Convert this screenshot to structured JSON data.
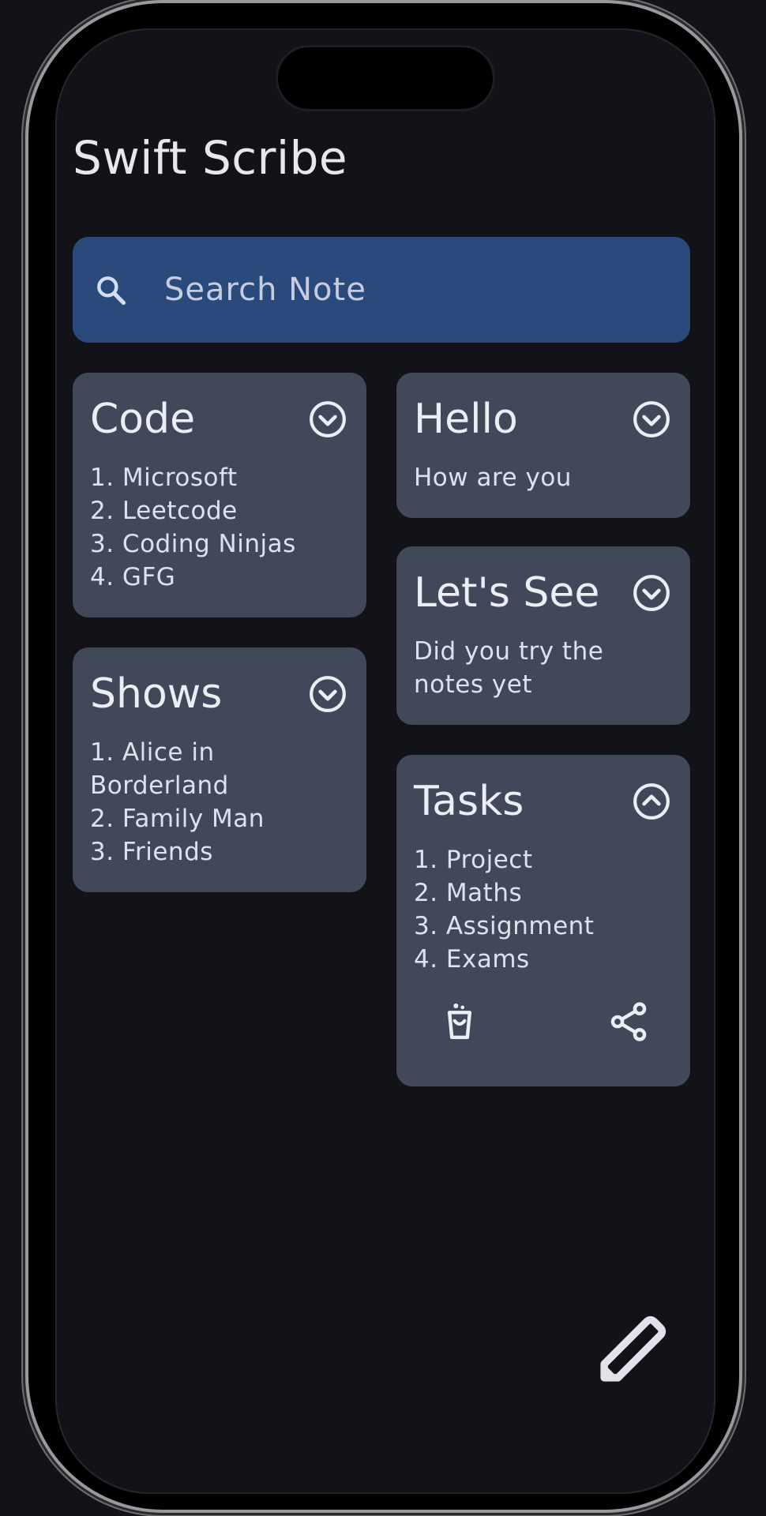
{
  "app": {
    "title": "Swift Scribe"
  },
  "search": {
    "placeholder": "Search Note",
    "icon": "search-icon"
  },
  "colors": {
    "background": "#121319",
    "search_bg": "#2b4a7c",
    "card_bg": "#40485a",
    "text": "#eceef5"
  },
  "notes": [
    {
      "title": "Code",
      "body": "1. Microsoft\n2. Leetcode\n3. Coding Ninjas\n4. GFG",
      "expanded": false,
      "toggle_icon": "chevron-down-circle-icon"
    },
    {
      "title": "Shows",
      "body": "1. Alice in\nBorderland\n2. Family Man\n3. Friends",
      "expanded": false,
      "toggle_icon": "chevron-down-circle-icon"
    },
    {
      "title": "Hello",
      "body": "How are you",
      "expanded": false,
      "toggle_icon": "chevron-down-circle-icon"
    },
    {
      "title": "Let's See",
      "body": "Did you try the\nnotes yet",
      "expanded": false,
      "toggle_icon": "chevron-down-circle-icon"
    },
    {
      "title": "Tasks",
      "body": "1. Project\n2. Maths\n3. Assignment\n4. Exams",
      "expanded": true,
      "toggle_icon": "chevron-up-circle-icon",
      "actions": [
        "delete-icon",
        "share-icon"
      ]
    }
  ],
  "fab": {
    "icon": "pencil-icon"
  }
}
